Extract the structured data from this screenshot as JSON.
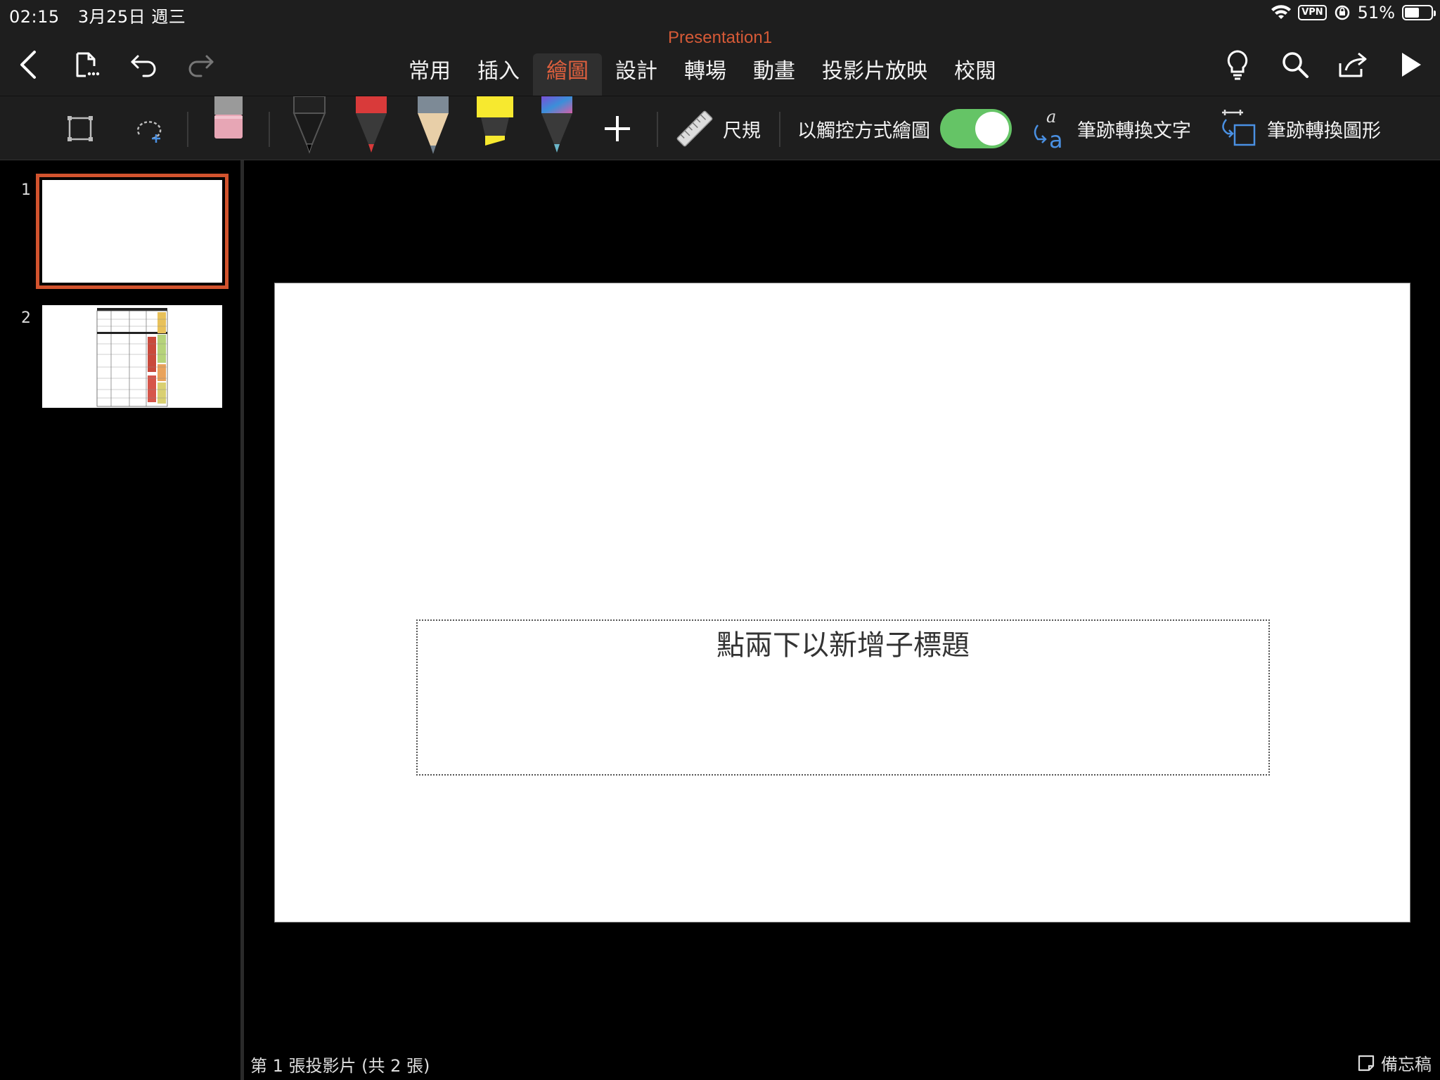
{
  "status_bar": {
    "time": "02:15",
    "date": "3月25日 週三",
    "vpn": "VPN",
    "battery": "51%"
  },
  "header": {
    "document_title": "Presentation1",
    "tabs": [
      {
        "label": "常用"
      },
      {
        "label": "插入"
      },
      {
        "label": "繪圖",
        "active": true
      },
      {
        "label": "設計"
      },
      {
        "label": "轉場"
      },
      {
        "label": "動畫"
      },
      {
        "label": "投影片放映"
      },
      {
        "label": "校閱"
      }
    ]
  },
  "draw_toolbar": {
    "ruler_label": "尺規",
    "draw_with_touch_label": "以觸控方式繪圖",
    "draw_with_touch_on": true,
    "ink_to_text_label": "筆跡轉換文字",
    "ink_to_shape_label": "筆跡轉換圖形",
    "pens": [
      "black-pen",
      "red-pen",
      "pencil",
      "yellow-highlighter",
      "galaxy-pen"
    ]
  },
  "slides_panel": {
    "slides": [
      {
        "number": "1",
        "selected": true
      },
      {
        "number": "2",
        "selected": false
      }
    ]
  },
  "canvas": {
    "subtitle_placeholder": "點兩下以新增子標題"
  },
  "footer": {
    "slide_counter": "第 1 張投影片 (共 2 張)",
    "notes_label": "備忘稿"
  },
  "colors": {
    "accent": "#d2532e",
    "toggle_on": "#65c466",
    "toolbar_bg": "#1e1e1e"
  }
}
